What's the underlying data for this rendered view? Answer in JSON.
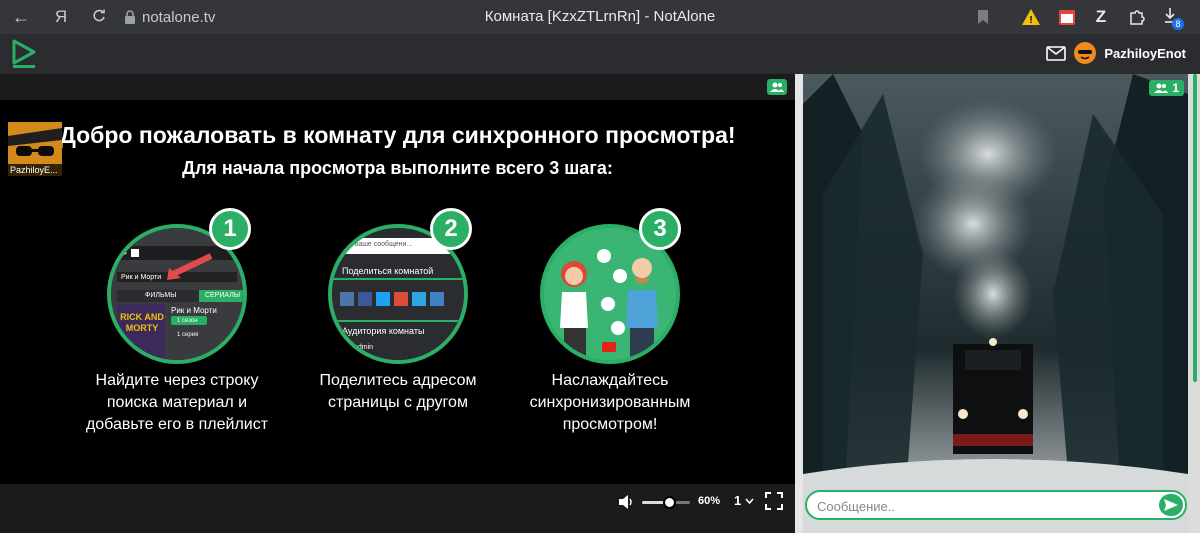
{
  "browser": {
    "url": "notalone.tv",
    "tab_title": "Комната [KzxZTLrnRn] - NotAlone",
    "download_badge": "8"
  },
  "header": {
    "username": "PazhiloyEnot"
  },
  "player": {
    "welcome_title": "Добро пожаловать в комнату для синхронного просмотра!",
    "welcome_sub": "Для начала просмотра выполните всего 3 шага:",
    "avatar_name": "PazhiloyE...",
    "steps": [
      {
        "number": "1",
        "caption": "Найдите через строку поиска материал и добавьте его в плейлист",
        "mock_search": "Рик и Морти",
        "mock_tab1": "ФИЛЬМЫ",
        "mock_tab2": "СЕРИАЛЫ",
        "mock_title": "Рик и Морти",
        "mock_season": "1 сезон",
        "mock_series": "1 серия",
        "poster_text": "RICK AND MORTY"
      },
      {
        "number": "2",
        "caption": "Поделитесь адресом страницы с другом",
        "mock_input": "...ите ваше сообщени...",
        "mock_share": "Поделиться комнатой",
        "mock_audience": "Аудитория комнаты",
        "mock_user": "admin"
      },
      {
        "number": "3",
        "caption": "Наслаждайтесь синхронизированным просмотром!"
      }
    ],
    "volume_percent": 60,
    "volume_label": "60%",
    "quality": "1"
  },
  "chat": {
    "viewers_count": "1",
    "input_placeholder": "Сообщение.."
  },
  "colors": {
    "accent": "#2bae66",
    "chrome": "#35363a",
    "header": "#2b2c2f"
  }
}
